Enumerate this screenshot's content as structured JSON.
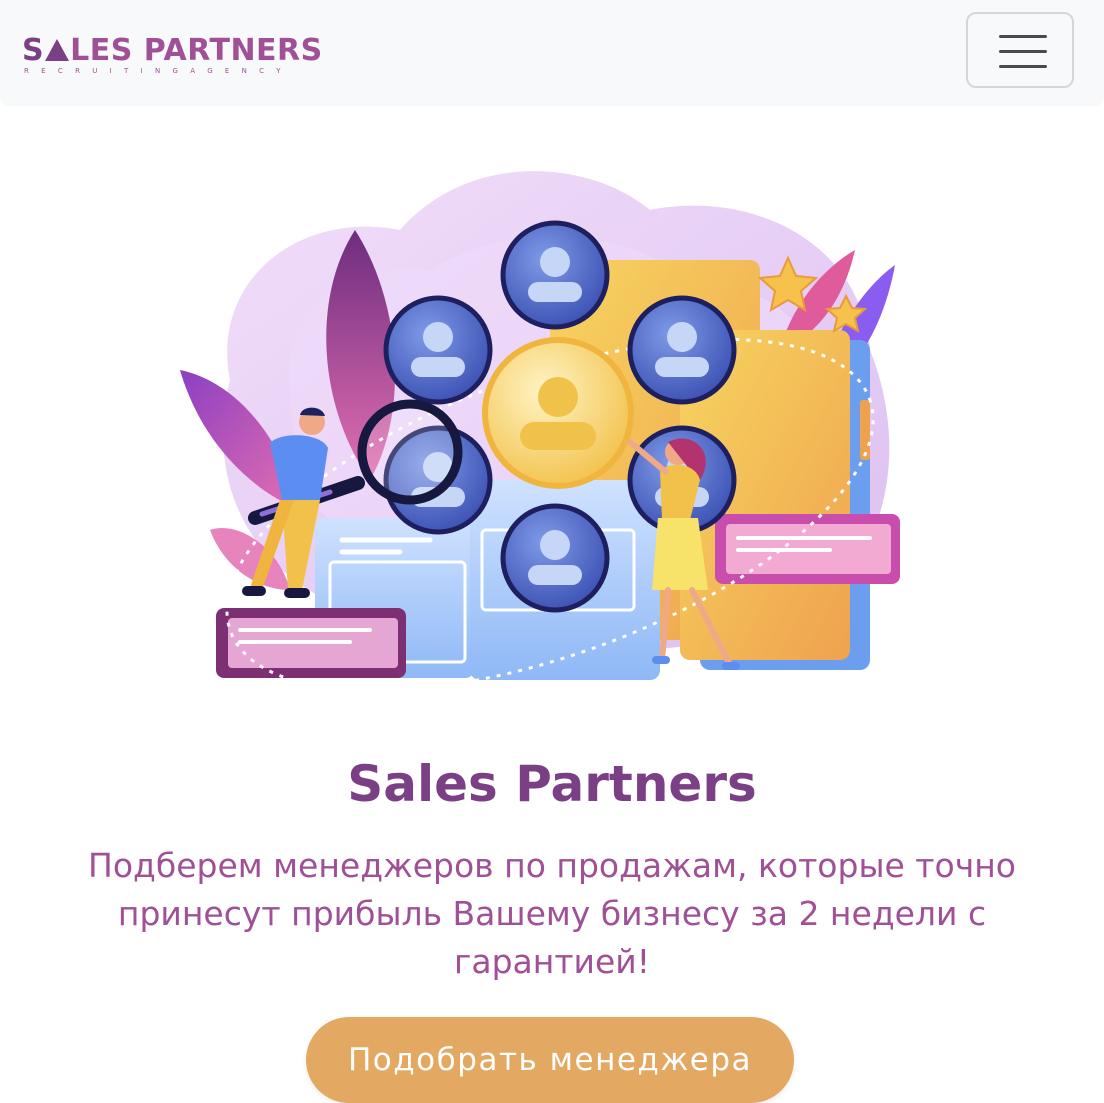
{
  "header": {
    "logo_main_part1": "S",
    "logo_main_part2": "LES PARTNERS",
    "logo_sub": "RECRUITINGAGENCY",
    "menu_icon": "hamburger-menu-icon"
  },
  "hero": {
    "illustration": "recruitment-illustration",
    "title": "Sales Partners",
    "subtitle": "Подберем менеджеров по продажам, которые точно принесут прибыль Вашему бизнесу за 2 недели с гарантией!",
    "cta_label": "Подобрать менеджера"
  },
  "colors": {
    "brand_purple": "#7b3f86",
    "brand_pink": "#a05096",
    "cta_orange": "#e3a862",
    "navbar_bg": "#f8f9fa"
  }
}
